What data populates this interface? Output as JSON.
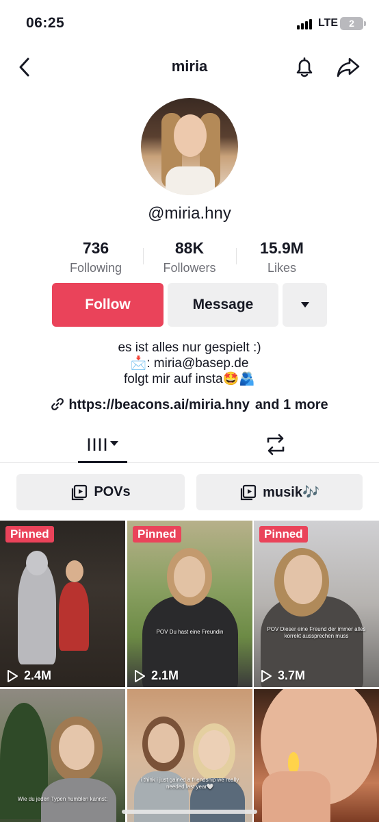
{
  "status_bar": {
    "time": "06:25",
    "network": "LTE",
    "battery": "2"
  },
  "nav": {
    "title": "miria"
  },
  "profile": {
    "username": "@miria.hny"
  },
  "stats": [
    {
      "value": "736",
      "label": "Following"
    },
    {
      "value": "88K",
      "label": "Followers"
    },
    {
      "value": "15.9M",
      "label": "Likes"
    }
  ],
  "actions": {
    "follow": "Follow",
    "message": "Message"
  },
  "bio": {
    "line1": "es ist alles nur gespielt :)",
    "line2": "📩: miria@basep.de",
    "line3": "folgt mir auf insta🤩🫂",
    "link": "https://beacons.ai/miria.hny",
    "link_more": "and 1 more"
  },
  "playlists": [
    {
      "label": "POVs"
    },
    {
      "label": "musik🎶"
    }
  ],
  "videos": [
    {
      "pinned": "Pinned",
      "views": "2.4M",
      "caption": ""
    },
    {
      "pinned": "Pinned",
      "views": "2.1M",
      "caption": "POV Du hast eine Freundin"
    },
    {
      "pinned": "Pinned",
      "views": "3.7M",
      "caption": "POV Dieser eine Freund der immer alles korrekt aussprechen muss"
    },
    {
      "pinned": "",
      "views": "",
      "caption": "Wie du jeden Typen humblen kannst:"
    },
    {
      "pinned": "",
      "views": "",
      "caption": "i think i just gained a friendship we really needed last year🤍"
    },
    {
      "pinned": "",
      "views": "",
      "caption": ""
    }
  ],
  "colors": {
    "accent": "#ea435a",
    "secondary_bg": "#efeff0",
    "muted_text": "#6d6e75"
  }
}
